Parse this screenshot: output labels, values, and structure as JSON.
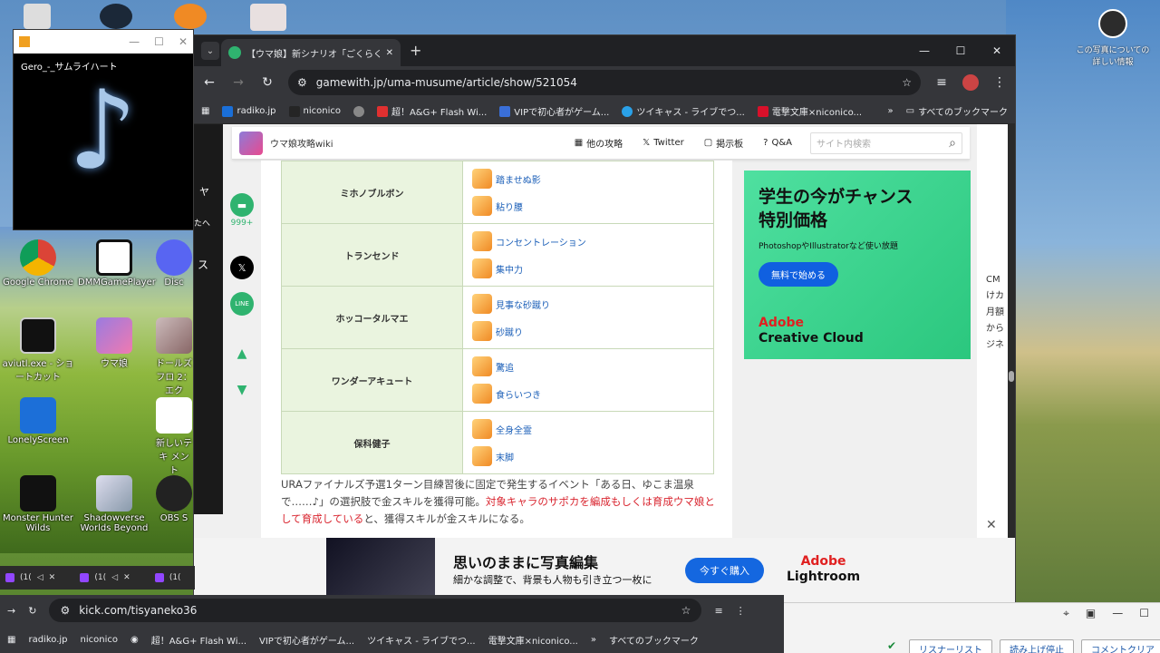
{
  "desktop": {
    "icons": [
      {
        "label": "Google Chrome"
      },
      {
        "label": "DMMGamePlayer"
      },
      {
        "label": "Disc"
      },
      {
        "label": "aviutl.exe - ショートカット"
      },
      {
        "label": "ウマ娘"
      },
      {
        "label": "ドールズフロ 2：エク"
      },
      {
        "label": "LonelyScreen"
      },
      {
        "label": "新しいテキ メント"
      },
      {
        "label": "Monster Hunter Wilds"
      },
      {
        "label": "Shadowverse Worlds Beyond"
      },
      {
        "label": "OBS S"
      }
    ],
    "topright_label": "この写真についての詳しい情報"
  },
  "media_player": {
    "title": "Gero_-_サムライハート",
    "minimize": "—",
    "maximize": "☐",
    "close": "✕"
  },
  "browser": {
    "tab_title": "【ウマ娘】新シナリオ「ごくらく♪ゆこま",
    "tab_close": "✕",
    "new_tab": "+",
    "url": "gamewith.jp/uma-musume/article/show/521054",
    "window": {
      "minimize": "—",
      "maximize": "☐",
      "close": "✕"
    },
    "bookmarks": [
      {
        "label": "radiko.jp",
        "color": "#1a6fd8"
      },
      {
        "label": "niconico",
        "color": "#252525"
      },
      {
        "label": "",
        "color": "#888888"
      },
      {
        "label": "超！A&G+ Flash Wi...",
        "color": "#e03030"
      },
      {
        "label": "VIPで初心者がゲーム...",
        "color": "#3a6fd8"
      },
      {
        "label": "ツイキャス - ライブでつ...",
        "color": "#2aa1e8"
      },
      {
        "label": "電撃文庫×niconico...",
        "color": "#d8102a"
      }
    ],
    "bookmarks_more": "»",
    "all_bookmarks": "すべてのブックマーク"
  },
  "site": {
    "name": "ウマ娘攻略wiki",
    "nav": [
      {
        "label": "他の攻略",
        "icon": "grid-icon"
      },
      {
        "label": "Twitter",
        "icon": "x-icon"
      },
      {
        "label": "掲示板",
        "icon": "chat-icon"
      },
      {
        "label": "Q&A",
        "icon": "question-icon"
      }
    ],
    "search_placeholder": "サイト内検索",
    "comment_count": "999+",
    "side_labels": [
      "ヤ",
      "たへ",
      "ス"
    ],
    "skill_rows": [
      {
        "name": "ミホノブルボン",
        "skills": [
          "踏ませぬ影",
          "粘り腰"
        ]
      },
      {
        "name": "トランセンド",
        "skills": [
          "コンセントレーション",
          "集中力"
        ]
      },
      {
        "name": "ホッコータルマエ",
        "skills": [
          "見事な砂蹴り",
          "砂蹴り"
        ]
      },
      {
        "name": "ワンダーアキュート",
        "skills": [
          "驚追",
          "食らいつき"
        ]
      },
      {
        "name": "保科健子",
        "skills": [
          "全身全霊",
          "末脚"
        ]
      }
    ],
    "paragraph": {
      "part1": "URAファイナルズ予選1ターン目練習後に固定で発生するイベント「ある日、ゆこま温泉で……♪」の選択肢で金スキルを獲得可能。",
      "red": "対象キャラのサポカを編成もしくは育成ウマ娘として育成している",
      "part2": "と、獲得スキルが金スキルになる。"
    }
  },
  "ad_right": {
    "headline": "学生の今がチャンス",
    "headline2": "特別価格",
    "sub": "PhotoshopやIllustratorなど使い放題",
    "button": "無料で始める",
    "brand1": "Adobe",
    "brand2": "Creative Cloud"
  },
  "right_partial_text": [
    "CM",
    "けカ",
    "月額",
    "から",
    "ジネ"
  ],
  "ad_bottom": {
    "headline": "思いのままに写真編集",
    "sub": "細かな調整で、背景も人物も引き立つ一枚に",
    "button": "今すぐ購入",
    "brand1": "Adobe",
    "brand2": "Lightroom",
    "close": "✕"
  },
  "kick_tabs": [
    {
      "label": "(1("
    },
    {
      "label": "(1("
    },
    {
      "label": "(1("
    }
  ],
  "bottom_browser": {
    "url": "kick.com/tisyaneko36",
    "bookmarks": [
      "radiko.jp",
      "niconico",
      "",
      "超！A&G+ Flash Wi...",
      "VIPで初心者がゲーム...",
      "ツイキャス - ライブでつ...",
      "電撃文庫×niconico..."
    ],
    "more": "»",
    "all": "すべてのブックマーク"
  },
  "right_panel": {
    "buttons": [
      "リスナーリスト",
      "読み上げ停止",
      "コメントクリア"
    ]
  }
}
